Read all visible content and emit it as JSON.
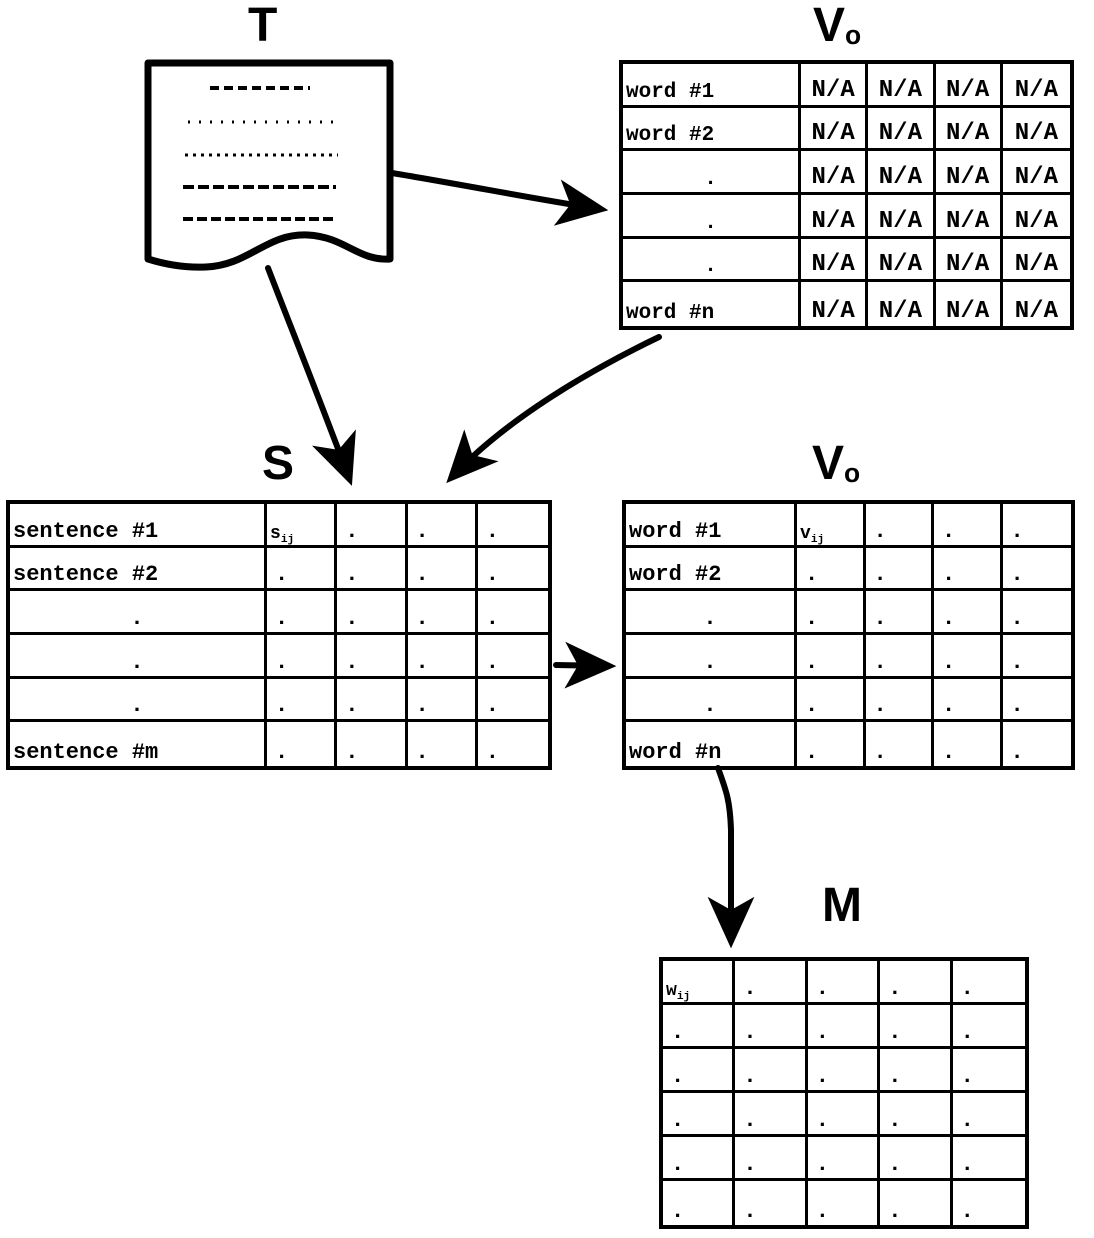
{
  "diagram": {
    "labels": {
      "text_doc": "T",
      "vocab_initial": "V",
      "vocab_initial_sub": "o",
      "sentence_matrix": "S",
      "vocab_filled": "V",
      "vocab_filled_sub": "o",
      "model_matrix": "M"
    },
    "document": {
      "name": "text-document",
      "line_count": 5
    },
    "vocab_initial_table": {
      "title": "Vo",
      "rows": [
        {
          "label": "word #1",
          "cells": [
            "N/A",
            "N/A",
            "N/A",
            "N/A"
          ]
        },
        {
          "label": "word #2",
          "cells": [
            "N/A",
            "N/A",
            "N/A",
            "N/A"
          ]
        },
        {
          "label": ".",
          "cells": [
            "N/A",
            "N/A",
            "N/A",
            "N/A"
          ]
        },
        {
          "label": ".",
          "cells": [
            "N/A",
            "N/A",
            "N/A",
            "N/A"
          ]
        },
        {
          "label": ".",
          "cells": [
            "N/A",
            "N/A",
            "N/A",
            "N/A"
          ]
        },
        {
          "label": "word #n",
          "cells": [
            "N/A",
            "N/A",
            "N/A",
            "N/A"
          ]
        }
      ]
    },
    "sentence_table": {
      "title": "S",
      "first_value": "s",
      "first_value_sub": "ij",
      "rows": [
        {
          "label": "sentence #1",
          "cells": [
            "",
            ".",
            ".",
            "."
          ]
        },
        {
          "label": "sentence #2",
          "cells": [
            ".",
            ".",
            ".",
            "."
          ]
        },
        {
          "label": ".",
          "cells": [
            ".",
            ".",
            ".",
            "."
          ]
        },
        {
          "label": ".",
          "cells": [
            ".",
            ".",
            ".",
            "."
          ]
        },
        {
          "label": ".",
          "cells": [
            ".",
            ".",
            ".",
            "."
          ]
        },
        {
          "label": "sentence #m",
          "cells": [
            ".",
            ".",
            ".",
            "."
          ]
        }
      ]
    },
    "vocab_filled_table": {
      "title": "Vo",
      "first_value": "v",
      "first_value_sub": "ij",
      "rows": [
        {
          "label": "word #1",
          "cells": [
            "",
            ".",
            ".",
            "."
          ]
        },
        {
          "label": "word #2",
          "cells": [
            ".",
            ".",
            ".",
            "."
          ]
        },
        {
          "label": ".",
          "cells": [
            ".",
            ".",
            ".",
            "."
          ]
        },
        {
          "label": ".",
          "cells": [
            ".",
            ".",
            ".",
            "."
          ]
        },
        {
          "label": ".",
          "cells": [
            ".",
            ".",
            ".",
            "."
          ]
        },
        {
          "label": "word #n",
          "cells": [
            ".",
            ".",
            ".",
            "."
          ]
        }
      ]
    },
    "model_table": {
      "title": "M",
      "first_value": "w",
      "first_value_sub": "ij",
      "rows": [
        {
          "cells": [
            "",
            ".",
            ".",
            ".",
            "."
          ]
        },
        {
          "cells": [
            ".",
            ".",
            ".",
            ".",
            "."
          ]
        },
        {
          "cells": [
            ".",
            ".",
            ".",
            ".",
            "."
          ]
        },
        {
          "cells": [
            ".",
            ".",
            ".",
            ".",
            "."
          ]
        },
        {
          "cells": [
            ".",
            ".",
            ".",
            ".",
            "."
          ]
        },
        {
          "cells": [
            ".",
            ".",
            ".",
            ".",
            "."
          ]
        }
      ]
    },
    "arrows": [
      {
        "name": "arrow-doc-to-vocab-initial",
        "from": "text-document",
        "to": "vocab-initial-table"
      },
      {
        "name": "arrow-doc-to-sentence-table",
        "from": "text-document",
        "to": "sentence-table"
      },
      {
        "name": "arrow-vocab-initial-to-sentence-table",
        "from": "vocab-initial-table",
        "to": "sentence-table"
      },
      {
        "name": "arrow-sentence-table-to-vocab-filled",
        "from": "sentence-table",
        "to": "vocab-filled-table"
      },
      {
        "name": "arrow-vocab-filled-to-model",
        "from": "vocab-filled-table",
        "to": "model-table"
      }
    ],
    "colors": {
      "stroke": "#000000",
      "background": "#ffffff"
    }
  }
}
